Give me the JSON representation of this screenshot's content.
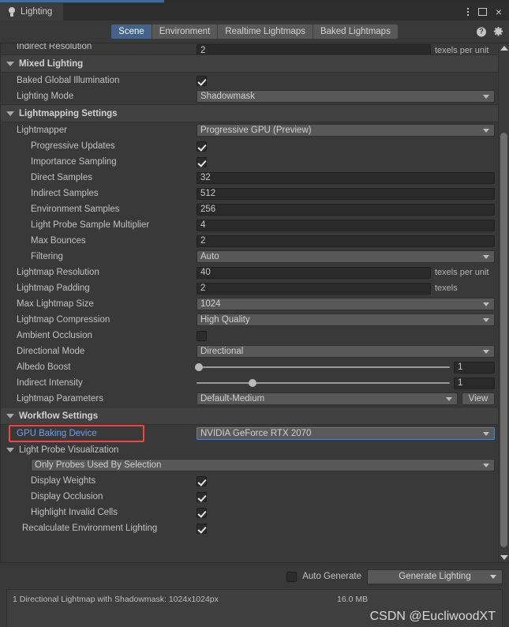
{
  "window": {
    "title": "Lighting",
    "icon": "lightbulb-icon",
    "controls": {
      "menu": "⋮",
      "maximize": "maximize-icon",
      "close": "×"
    }
  },
  "toolbar": {
    "tabs": [
      {
        "label": "Scene",
        "active": true
      },
      {
        "label": "Environment",
        "active": false
      },
      {
        "label": "Realtime Lightmaps",
        "active": false
      },
      {
        "label": "Baked Lightmaps",
        "active": false
      }
    ],
    "help_icon": "?",
    "settings_icon": "gear-icon"
  },
  "clipped_row": {
    "label": "Indirect Resolution",
    "value": "2",
    "unit": "texels per unit"
  },
  "sections": {
    "mixed_lighting": {
      "title": "Mixed Lighting",
      "rows": [
        {
          "label": "Baked Global Illumination",
          "type": "checkbox",
          "checked": true
        },
        {
          "label": "Lighting Mode",
          "type": "dropdown",
          "value": "Shadowmask"
        }
      ]
    },
    "lightmapping_settings": {
      "title": "Lightmapping Settings",
      "rows": [
        {
          "label": "Lightmapper",
          "type": "dropdown",
          "value": "Progressive GPU (Preview)",
          "indent": 0
        },
        {
          "label": "Progressive Updates",
          "type": "checkbox",
          "checked": true,
          "indent": 1
        },
        {
          "label": "Importance Sampling",
          "type": "checkbox",
          "checked": true,
          "indent": 1
        },
        {
          "label": "Direct Samples",
          "type": "text",
          "value": "32",
          "indent": 1
        },
        {
          "label": "Indirect Samples",
          "type": "text",
          "value": "512",
          "indent": 1
        },
        {
          "label": "Environment Samples",
          "type": "text",
          "value": "256",
          "indent": 1
        },
        {
          "label": "Light Probe Sample Multiplier",
          "type": "text",
          "value": "4",
          "indent": 1
        },
        {
          "label": "Max Bounces",
          "type": "text",
          "value": "2",
          "indent": 1
        },
        {
          "label": "Filtering",
          "type": "dropdown",
          "value": "Auto",
          "indent": 1
        },
        {
          "label": "Lightmap Resolution",
          "type": "text",
          "value": "40",
          "unit": "texels per unit",
          "indent": 0
        },
        {
          "label": "Lightmap Padding",
          "type": "text",
          "value": "2",
          "unit": "texels",
          "indent": 0
        },
        {
          "label": "Max Lightmap Size",
          "type": "dropdown",
          "value": "1024",
          "indent": 0
        },
        {
          "label": "Lightmap Compression",
          "type": "dropdown",
          "value": "High Quality",
          "indent": 0
        },
        {
          "label": "Ambient Occlusion",
          "type": "checkbox",
          "checked": false,
          "indent": 0
        },
        {
          "label": "Directional Mode",
          "type": "dropdown",
          "value": "Directional",
          "indent": 0
        },
        {
          "label": "Albedo Boost",
          "type": "slider",
          "value": "1",
          "fill": 0,
          "indent": 0
        },
        {
          "label": "Indirect Intensity",
          "type": "slider",
          "value": "1",
          "fill": 22,
          "indent": 0
        },
        {
          "label": "Lightmap Parameters",
          "type": "dropdown-view",
          "value": "Default-Medium",
          "button": "View",
          "indent": 0
        }
      ]
    },
    "workflow_settings": {
      "title": "Workflow Settings",
      "gpu_baking_device": {
        "label": "GPU Baking Device",
        "value": "NVIDIA GeForce RTX 2070",
        "highlighted": true,
        "annotation_color": "#f4443f",
        "label_color": "#6f9eea"
      },
      "light_probe_visualization": {
        "title": "Light Probe Visualization",
        "mode": "Only Probes Used By Selection",
        "rows": [
          {
            "label": "Display Weights",
            "checked": true
          },
          {
            "label": "Display Occlusion",
            "checked": true
          },
          {
            "label": "Highlight Invalid Cells",
            "checked": true
          }
        ]
      },
      "recalculate": {
        "label": "Recalculate Environment Lighting",
        "checked": true
      }
    }
  },
  "footer": {
    "auto_generate": {
      "label": "Auto Generate",
      "checked": false
    },
    "generate_button": "Generate Lighting",
    "status_left": "1 Directional Lightmap with Shadowmask: 1024x1024px",
    "status_size": "16.0 MB",
    "watermark": "CSDN @EucliwoodXT"
  }
}
